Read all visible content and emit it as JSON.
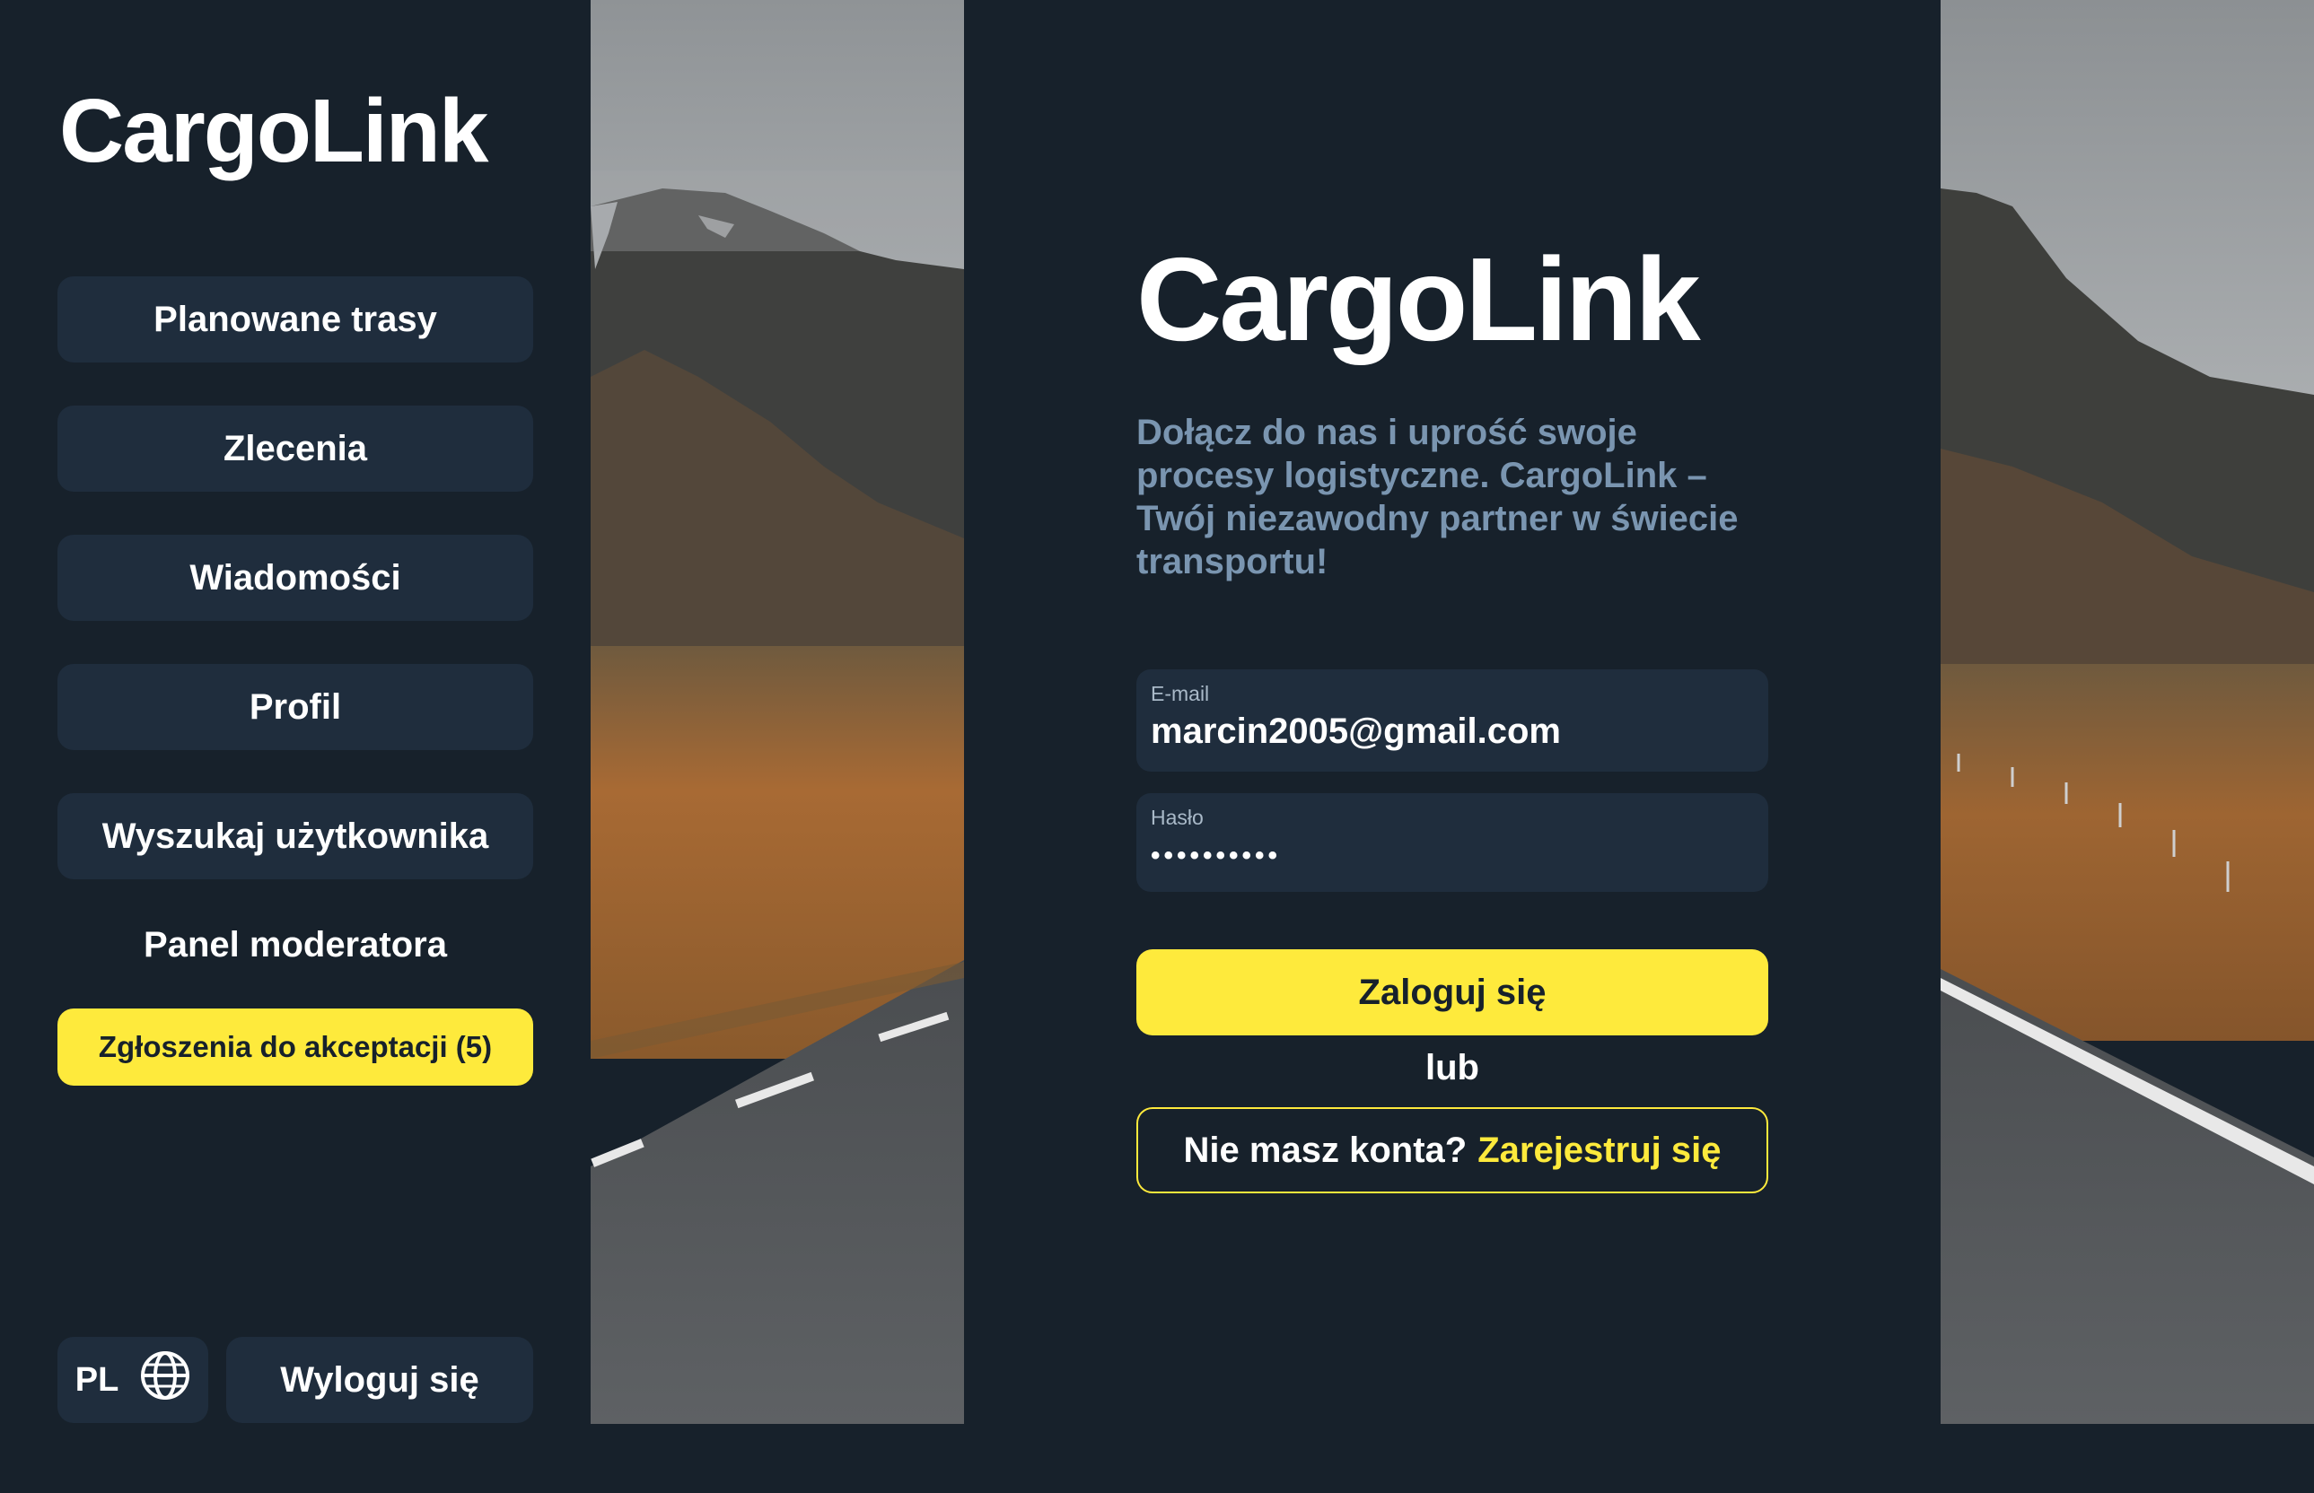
{
  "sidebar": {
    "brand": "CargoLink",
    "items": [
      {
        "label": "Planowane trasy"
      },
      {
        "label": "Zlecenia"
      },
      {
        "label": "Wiadomości"
      },
      {
        "label": "Profil"
      },
      {
        "label": "Wyszukaj użytkownika"
      }
    ],
    "moderator_section": "Panel moderatora",
    "pending_label": "Zgłoszenia do akceptacji (5)",
    "language": "PL",
    "language_icon": "globe-icon",
    "logout_label": "Wyloguj się"
  },
  "login": {
    "title": "CargoLink",
    "tagline": "Dołącz do nas i uprość swoje procesy logistyczne. CargoLink – Twój niezawodny partner w świecie transportu!",
    "email_label": "E-mail",
    "email_value": "marcin2005@gmail.com",
    "password_label": "Hasło",
    "password_mask": "••••••••••",
    "login_button": "Zaloguj się",
    "or_text": "lub",
    "register_prompt": "Nie masz konta?",
    "register_link": "Zarejestruj się"
  },
  "colors": {
    "background": "#17212b",
    "button": "#1f2d3d",
    "accent": "#feea3c",
    "tagline": "#7a95b0"
  }
}
